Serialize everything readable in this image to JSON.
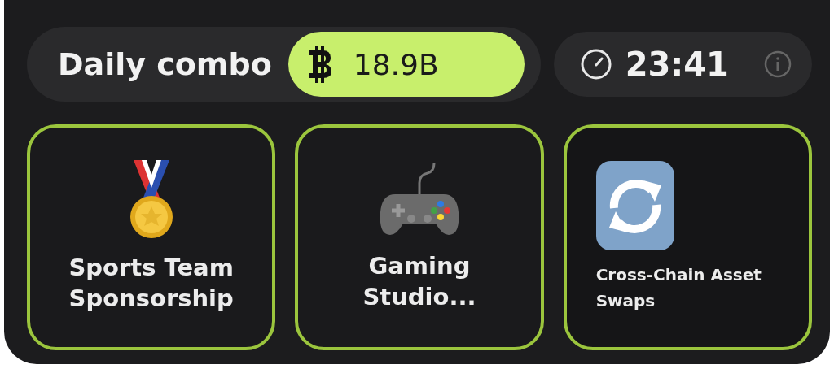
{
  "header": {
    "title": "Daily combo",
    "reward": "18.9B",
    "timer": "23:41"
  },
  "cards": [
    {
      "kind": "medal",
      "label": "Sports Team Sponsorship",
      "compact": false
    },
    {
      "kind": "gamepad",
      "label": "Gaming Studio...",
      "compact": false
    },
    {
      "kind": "sync",
      "label": "Cross-Chain Asset Swaps",
      "compact": true
    }
  ]
}
